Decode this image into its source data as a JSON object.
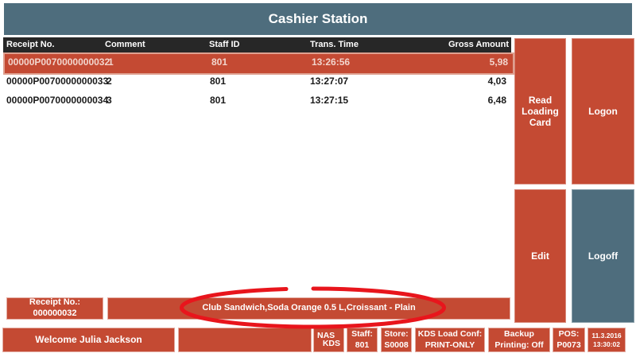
{
  "title": "Cashier Station",
  "colors": {
    "slate_header": "#4e6d7d",
    "accent_red": "#c44a33",
    "table_header_bg": "#272727",
    "selected_row_text": "#f2d5cd",
    "annotation_red": "#e8151c"
  },
  "table": {
    "columns": [
      "Receipt No.",
      "Comment",
      "Staff ID",
      "Trans. Time",
      "Gross Amount"
    ],
    "rows": [
      {
        "receipt_no": "00000P0070000000032",
        "comment": "1",
        "staff_id": "801",
        "trans_time": "13:26:56",
        "gross_amount": "5,98",
        "selected": true
      },
      {
        "receipt_no": "00000P0070000000033",
        "comment": "2",
        "staff_id": "801",
        "trans_time": "13:27:07",
        "gross_amount": "4,03",
        "selected": false
      },
      {
        "receipt_no": "00000P0070000000034",
        "comment": "3",
        "staff_id": "801",
        "trans_time": "13:27:15",
        "gross_amount": "6,48",
        "selected": false
      }
    ]
  },
  "buttons": {
    "read_loading_card": "Read Loading Card",
    "logon": "Logon",
    "edit": "Edit",
    "logoff": "Logoff"
  },
  "receipt_panel": {
    "label": "Receipt No.:",
    "value": "000000032",
    "items": "Club Sandwich,Soda Orange 0.5 L,Croissant - Plain"
  },
  "status_bar": {
    "welcome": "Welcome Julia Jackson",
    "nas": "NAS",
    "kds": "KDS",
    "staff_label": "Staff:",
    "staff_value": "801",
    "store_label": "Store:",
    "store_value": "S0008",
    "kds_conf_label": "KDS Load Conf:",
    "kds_conf_value": "PRINT-ONLY",
    "backup_line1": "Backup",
    "backup_line2": "Printing: Off",
    "pos_label": "POS:",
    "pos_value": "P0073",
    "date": "11.3.2016",
    "time": "13:30:02"
  }
}
